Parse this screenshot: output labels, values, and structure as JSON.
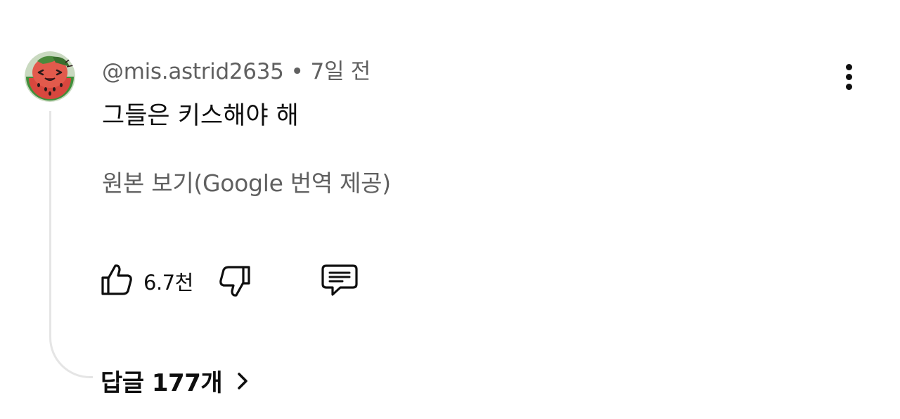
{
  "comment": {
    "author": "@mis.astrid2635",
    "separator": "•",
    "time": "7일 전",
    "text": "그들은 키스해야 해",
    "translate_label": "원본 보기(Google 번역 제공)",
    "like_count": "6.7천",
    "replies_label": "답글 177개"
  },
  "icons": {
    "avatar": "watermelon-avatar-icon",
    "more": "vertical-ellipsis-icon",
    "like": "thumb-up-icon",
    "dislike": "thumb-down-icon",
    "reply": "comment-bubble-icon",
    "chevron": "chevron-right-icon"
  },
  "colors": {
    "primary_text": "#0f0f0f",
    "secondary_text": "#606060",
    "thread_line": "#e5e5e5",
    "background": "#ffffff"
  }
}
